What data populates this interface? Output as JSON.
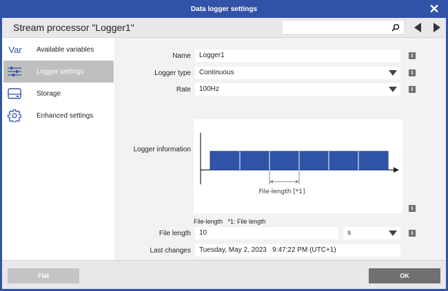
{
  "window": {
    "title": "Data logger settings"
  },
  "header": {
    "title": "Stream processor \"Logger1\"",
    "search": {
      "value": "",
      "placeholder": ""
    }
  },
  "sidebar": {
    "items": [
      {
        "icon_text": "Var",
        "icon": "var-icon",
        "label": "Available variables",
        "active": false
      },
      {
        "icon": "sliders-icon",
        "label": "Logger settings",
        "active": true
      },
      {
        "icon": "storage-icon",
        "label": "Storage",
        "active": false
      },
      {
        "icon": "gear-icon",
        "label": "Enhanced settings",
        "active": false
      }
    ]
  },
  "form": {
    "name": {
      "label": "Name",
      "value": "Logger1"
    },
    "logger_type": {
      "label": "Logger type",
      "value": "Continuous"
    },
    "rate": {
      "label": "Rate",
      "value": "100Hz"
    },
    "logger_info": {
      "label": "Logger information",
      "diagram_label": "File-length [*1]"
    },
    "caption": "File-length   *1: File length",
    "file_length": {
      "label": "File length",
      "value": "10",
      "unit": "s"
    },
    "last_changes": {
      "label": "Last changes",
      "value": "Tuesday, May 2, 2023   9:47:22 PM (UTC+1)"
    },
    "info_glyph": "i"
  },
  "footer": {
    "flat_label": "Flat",
    "ok_label": "OK"
  },
  "colors": {
    "accent": "#3152a7",
    "bar_fill": "#2f54a8",
    "active_item": "#bfbfbf"
  }
}
